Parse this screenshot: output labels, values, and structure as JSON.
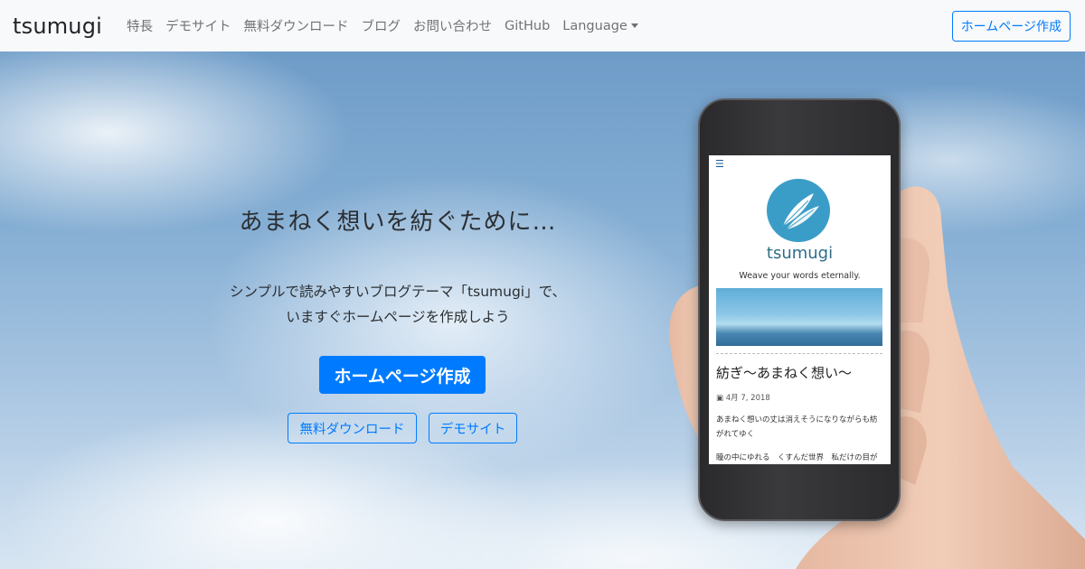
{
  "navbar": {
    "brand": "tsumugi",
    "links": [
      "特長",
      "デモサイト",
      "無料ダウンロード",
      "ブログ",
      "お問い合わせ",
      "GitHub"
    ],
    "language_label": "Language",
    "cta_label": "ホームページ作成"
  },
  "hero": {
    "headline": "あまねく想いを紡ぐために…",
    "subtext_line1": "シンプルで読みやすいブログテーマ「tsumugi」で、",
    "subtext_line2": "いますぐホームページを作成しよう",
    "primary_button": "ホームページ作成",
    "download_button": "無料ダウンロード",
    "demo_button": "デモサイト"
  },
  "phone_screen": {
    "menu_icon": "hamburger-icon",
    "brand": "tsumugi",
    "tagline": "Weave your words eternally.",
    "post_title": "紡ぎ〜あまねく想い〜",
    "post_date": "4月 7, 2018",
    "body_line1": "あまねく想いの丈は消えそうになりながらも紡がれてゆく",
    "body_line2": "瞳の中にゆれる　くすんだ世界　私だけの目が"
  },
  "colors": {
    "accent": "#007bff",
    "navbar_bg": "#f8f9fa",
    "logo_circle": "#3a9dc7"
  }
}
